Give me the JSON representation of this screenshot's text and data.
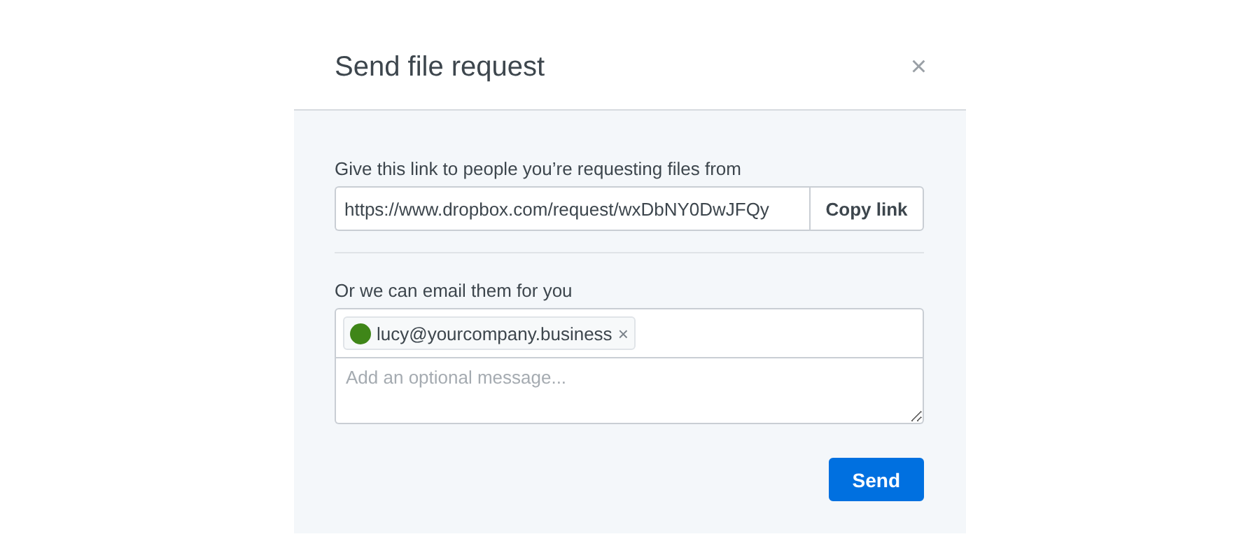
{
  "dialog": {
    "title": "Send file request",
    "close": "×"
  },
  "link_section": {
    "label": "Give this link to people you’re requesting files from",
    "link": "https://www.dropbox.com/request/wxDbNY0DwJFQy",
    "copy_button": "Copy link"
  },
  "email_section": {
    "label": "Or we can email them for you",
    "recipients": [
      {
        "email": "lucy@yourcompany.business",
        "color": "#3f8618",
        "remove": "×"
      }
    ],
    "message": {
      "placeholder": "Add an optional message..."
    }
  },
  "buttons": [
    {
      "label": "Send",
      "kind": "primary"
    }
  ]
}
